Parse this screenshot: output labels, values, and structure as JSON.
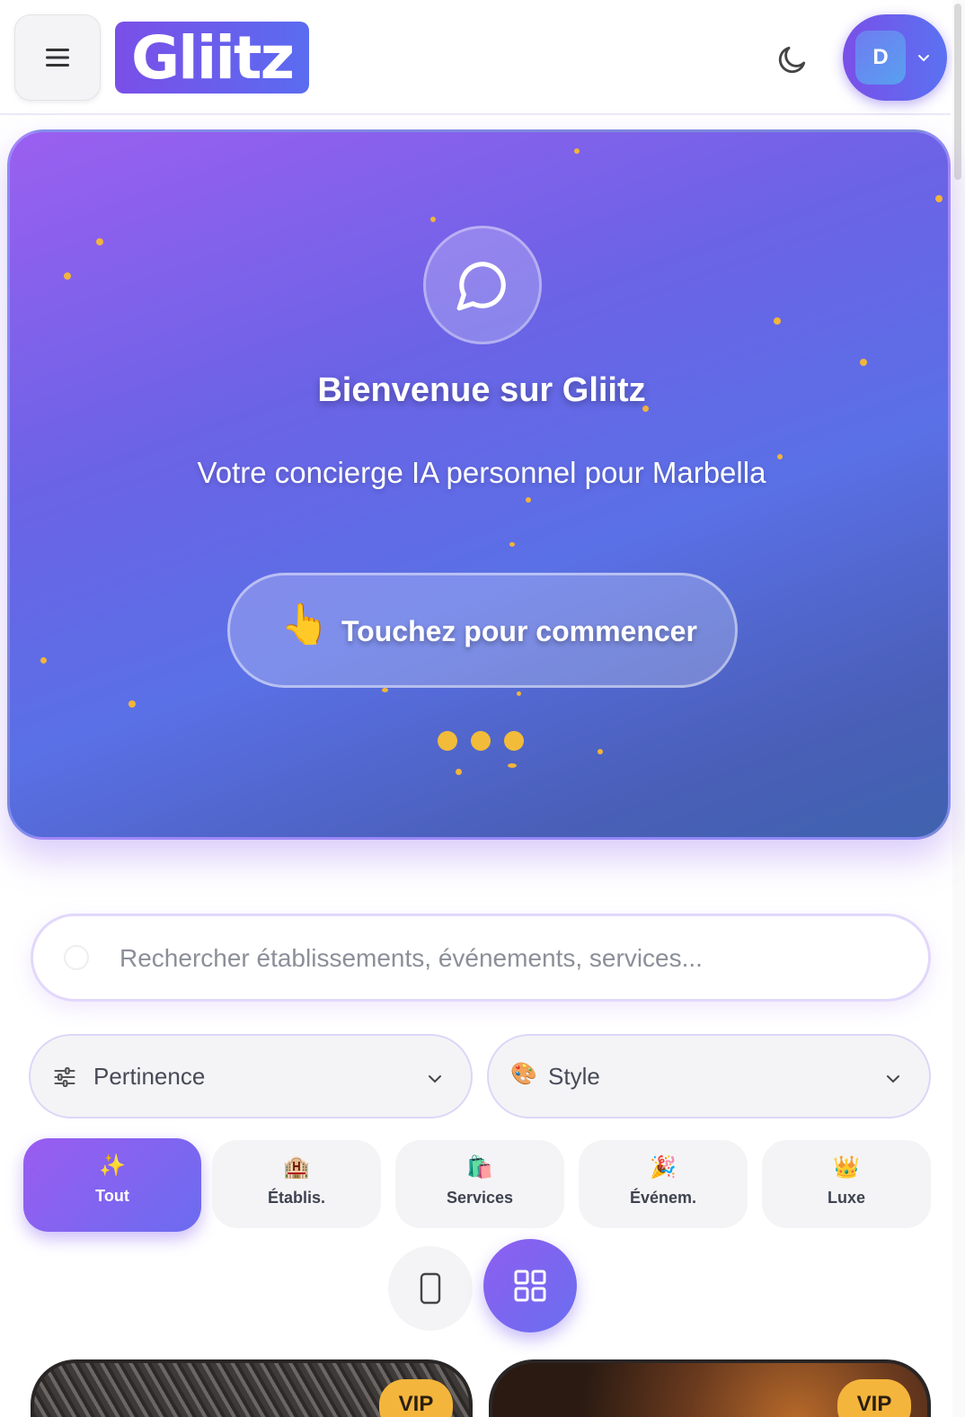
{
  "header": {
    "logo_text": "Gliitz",
    "avatar_initial": "D",
    "icons": {
      "menu": "hamburger-menu-icon",
      "theme": "moon-icon",
      "user_menu": "chevron-down-icon"
    }
  },
  "hero": {
    "title": "Bienvenue sur Gliitz",
    "subtitle": "Votre concierge IA personnel pour Marbella",
    "cta_emoji": "👆",
    "cta_label": "Touchez pour commencer",
    "icon": "chat-bubble-icon",
    "gradient": [
      "#9b5ff0",
      "#5a70e6",
      "#3f62ae"
    ]
  },
  "search": {
    "placeholder": "Rechercher établissements, événements, services...",
    "value": ""
  },
  "filters": {
    "sort": {
      "label": "Pertinence",
      "icon": "sliders-icon"
    },
    "style": {
      "label": "Style",
      "emoji": "🎨"
    }
  },
  "categories": [
    {
      "emoji": "✨",
      "label": "Tout",
      "active": true
    },
    {
      "emoji": "🏨",
      "label": "Établis.",
      "active": false
    },
    {
      "emoji": "🛍️",
      "label": "Services",
      "active": false
    },
    {
      "emoji": "🎉",
      "label": "Événem.",
      "active": false
    },
    {
      "emoji": "👑",
      "label": "Luxe",
      "active": false
    }
  ],
  "view_toggle": {
    "options": [
      "mobile-icon",
      "grid-icon"
    ],
    "selected": "grid"
  },
  "cards": [
    {
      "badge": "VIP"
    },
    {
      "badge": "VIP"
    }
  ],
  "colors": {
    "accent": "#7a4fe8",
    "accent2": "#5a6cf0",
    "gold": "#f4b53c"
  }
}
